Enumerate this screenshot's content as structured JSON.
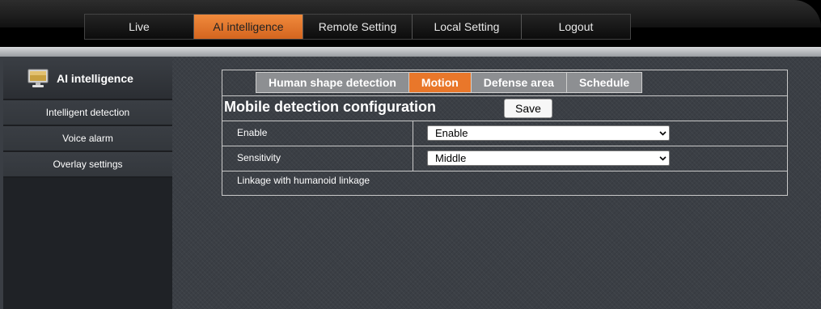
{
  "nav": {
    "tabs": [
      {
        "label": "Live",
        "active": false
      },
      {
        "label": "AI intelligence",
        "active": true
      },
      {
        "label": "Remote Setting",
        "active": false
      },
      {
        "label": "Local Setting",
        "active": false
      },
      {
        "label": "Logout",
        "active": false
      }
    ]
  },
  "sidebar": {
    "title": "AI intelligence",
    "icon": "monitor-icon",
    "items": [
      {
        "label": "Intelligent detection"
      },
      {
        "label": "Voice alarm"
      },
      {
        "label": "Overlay settings"
      }
    ]
  },
  "subtabs": [
    {
      "label": "Human shape detection",
      "active": false
    },
    {
      "label": "Motion",
      "active": true
    },
    {
      "label": "Defense area",
      "active": false
    },
    {
      "label": "Schedule",
      "active": false
    }
  ],
  "config": {
    "title": "Mobile detection configuration",
    "save_label": "Save",
    "enable": {
      "label": "Enable",
      "value": "Enable"
    },
    "sensitivity": {
      "label": "Sensitivity",
      "value": "Middle"
    },
    "linkage_label": "Linkage with humanoid linkage"
  },
  "colors": {
    "accent": "#e9772a",
    "inactive_tab": "#8d8f92",
    "top_bar": "#000000",
    "background": "#3b3f45"
  }
}
